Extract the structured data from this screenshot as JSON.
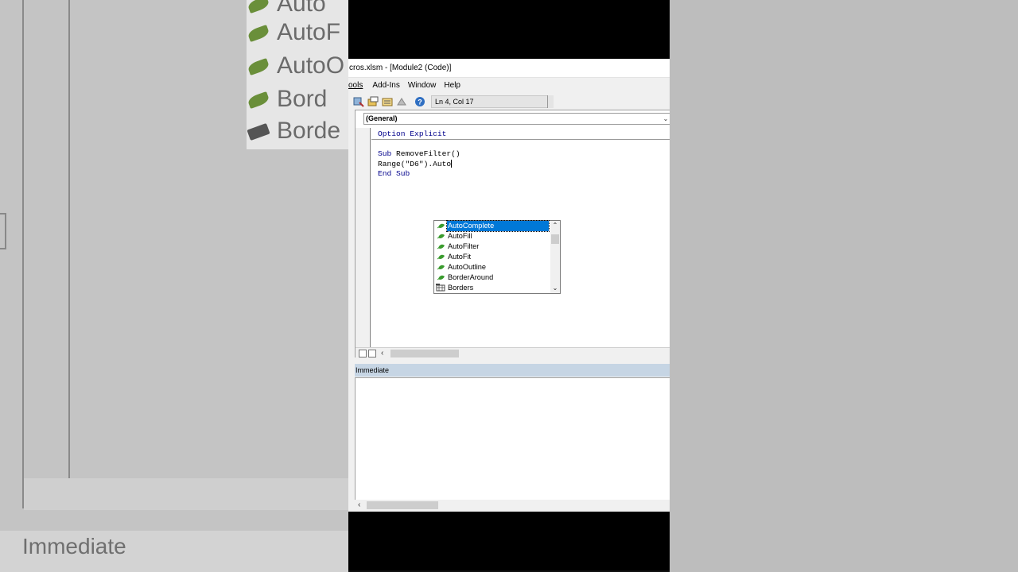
{
  "background": {
    "items": [
      "Auto",
      "AutoF",
      "AutoO",
      "Bord",
      "Borde"
    ],
    "immediate_label": "Immediate"
  },
  "window": {
    "title": "cros.xlsm - [Module2 (Code)]",
    "menu": {
      "tools": "ools",
      "addins": "Add-Ins",
      "window": "Window",
      "help": "Help"
    },
    "toolbar": {
      "status": "Ln 4, Col 17"
    },
    "code_window": {
      "object_combo": "(General)",
      "lines": {
        "option_kw": "Option Explicit",
        "sub_kw": "Sub",
        "sub_name": " RemoveFilter()",
        "range_line": "Range(\"D6\").Auto",
        "end_sub": "End Sub"
      }
    },
    "autocomplete": {
      "items": [
        "AutoComplete",
        "AutoFill",
        "AutoFilter",
        "AutoFit",
        "AutoOutline",
        "BorderAround",
        "Borders"
      ],
      "selected": "AutoComplete"
    },
    "immediate": {
      "title": "Immediate"
    }
  },
  "colors": {
    "selection": "#0078d7",
    "keyword": "#00008b",
    "method_icon": "#3a9b2e",
    "immediate_header": "#c6d5e4"
  }
}
